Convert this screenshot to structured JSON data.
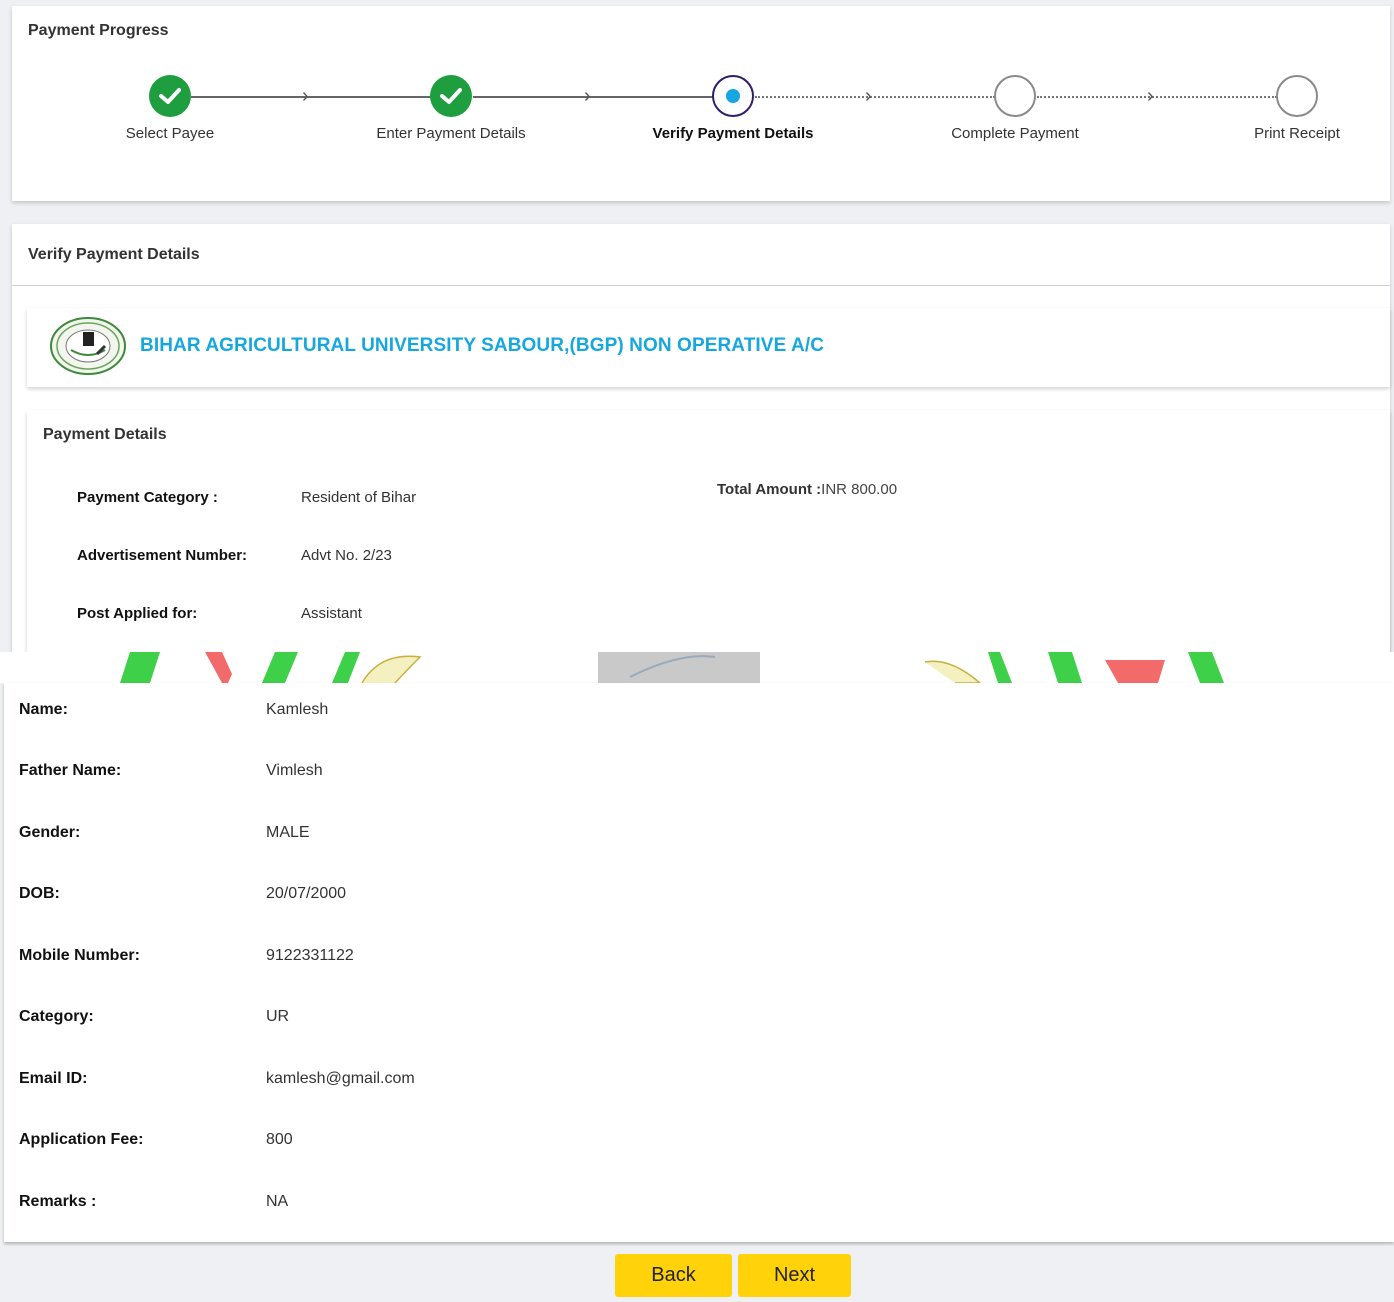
{
  "progress": {
    "title": "Payment Progress",
    "steps": [
      {
        "label": "Select Payee",
        "state": "done"
      },
      {
        "label": "Enter Payment Details",
        "state": "done"
      },
      {
        "label": "Verify Payment Details",
        "state": "current"
      },
      {
        "label": "Complete Payment",
        "state": "todo"
      },
      {
        "label": "Print Receipt",
        "state": "todo"
      }
    ]
  },
  "verify": {
    "title": "Verify Payment Details",
    "org_name": "BIHAR AGRICULTURAL UNIVERSITY SABOUR,(BGP) NON OPERATIVE A/C"
  },
  "payment_details": {
    "title": "Payment Details",
    "category_label": "Payment Category :",
    "category_value": "Resident of Bihar",
    "advt_label": "Advertisement Number:",
    "advt_value": "Advt No. 2/23",
    "post_label": "Post Applied for:",
    "post_value": "Assistant",
    "total_label": "Total Amount :",
    "total_value": "INR 800.00"
  },
  "personal": [
    {
      "label": "Name:",
      "value": "Kamlesh"
    },
    {
      "label": "Father Name:",
      "value": "Vimlesh"
    },
    {
      "label": "Gender:",
      "value": "MALE"
    },
    {
      "label": "DOB:",
      "value": "20/07/2000"
    },
    {
      "label": "Mobile Number:",
      "value": "9122331122"
    },
    {
      "label": "Category:",
      "value": "UR"
    },
    {
      "label": "Email ID:",
      "value": "kamlesh@gmail.com"
    },
    {
      "label": "Application Fee:",
      "value": "800"
    },
    {
      "label": "Remarks :",
      "value": "NA"
    }
  ],
  "buttons": {
    "back": "Back",
    "next": "Next"
  },
  "colors": {
    "done": "#1e9e3e",
    "current_ring": "#2d1e6b",
    "current_dot": "#16a6e1",
    "org_name": "#17a7df",
    "button": "#ffd20a"
  }
}
